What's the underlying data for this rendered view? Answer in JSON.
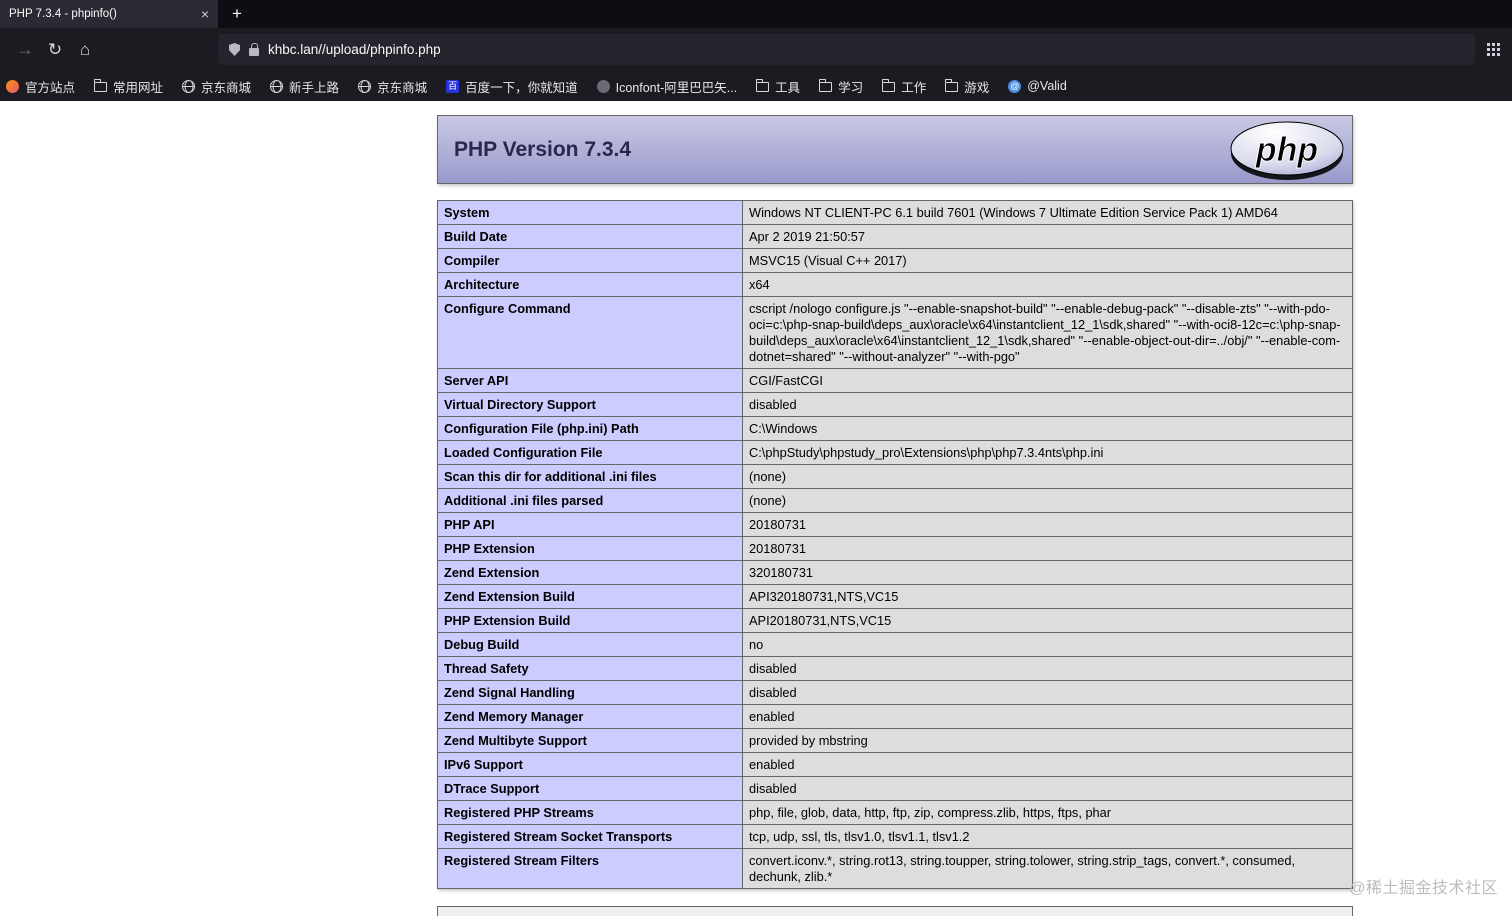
{
  "browser": {
    "tab": {
      "title": "PHP 7.3.4 - phpinfo()"
    },
    "glyphs": {
      "close": "×",
      "new_tab": "+",
      "forward": "→",
      "reload": "↻",
      "home": "⌂"
    },
    "url": "khbc.lan//upload/phpinfo.php",
    "bookmarks": [
      {
        "label": "官方站点",
        "icon": "site",
        "icon_text": ""
      },
      {
        "label": "常用网址",
        "icon": "folder",
        "icon_text": ""
      },
      {
        "label": "京东商城",
        "icon": "globe",
        "icon_text": ""
      },
      {
        "label": "新手上路",
        "icon": "globe",
        "icon_text": ""
      },
      {
        "label": "京东商城",
        "icon": "globe",
        "icon_text": ""
      },
      {
        "label": "百度一下，你就知道",
        "icon": "baidu",
        "icon_text": "百"
      },
      {
        "label": "Iconfont-阿里巴巴矢...",
        "icon": "iconfont",
        "icon_text": ""
      },
      {
        "label": "工具",
        "icon": "folder",
        "icon_text": ""
      },
      {
        "label": "学习",
        "icon": "folder",
        "icon_text": ""
      },
      {
        "label": "工作",
        "icon": "folder",
        "icon_text": ""
      },
      {
        "label": "游戏",
        "icon": "folder",
        "icon_text": ""
      },
      {
        "label": "@Valid",
        "icon": "at",
        "icon_text": "@"
      }
    ]
  },
  "page": {
    "title": "PHP Version 7.3.4",
    "logo_text": "php",
    "watermark": "@稀土掘金技术社区",
    "colors": {
      "header_bg": "#9999cc",
      "label_cell_bg": "#ccccff",
      "value_cell_bg": "#dddddd"
    },
    "info_rows": [
      {
        "label": "System",
        "value": "Windows NT CLIENT-PC 6.1 build 7601 (Windows 7 Ultimate Edition Service Pack 1) AMD64"
      },
      {
        "label": "Build Date",
        "value": "Apr 2 2019 21:50:57"
      },
      {
        "label": "Compiler",
        "value": "MSVC15 (Visual C++ 2017)"
      },
      {
        "label": "Architecture",
        "value": "x64"
      },
      {
        "label": "Configure Command",
        "value": "cscript /nologo configure.js \"--enable-snapshot-build\" \"--enable-debug-pack\" \"--disable-zts\" \"--with-pdo-oci=c:\\php-snap-build\\deps_aux\\oracle\\x64\\instantclient_12_1\\sdk,shared\" \"--with-oci8-12c=c:\\php-snap-build\\deps_aux\\oracle\\x64\\instantclient_12_1\\sdk,shared\" \"--enable-object-out-dir=../obj/\" \"--enable-com-dotnet=shared\" \"--without-analyzer\" \"--with-pgo\""
      },
      {
        "label": "Server API",
        "value": "CGI/FastCGI"
      },
      {
        "label": "Virtual Directory Support",
        "value": "disabled"
      },
      {
        "label": "Configuration File (php.ini) Path",
        "value": "C:\\Windows"
      },
      {
        "label": "Loaded Configuration File",
        "value": "C:\\phpStudy\\phpstudy_pro\\Extensions\\php\\php7.3.4nts\\php.ini"
      },
      {
        "label": "Scan this dir for additional .ini files",
        "value": "(none)"
      },
      {
        "label": "Additional .ini files parsed",
        "value": "(none)"
      },
      {
        "label": "PHP API",
        "value": "20180731"
      },
      {
        "label": "PHP Extension",
        "value": "20180731"
      },
      {
        "label": "Zend Extension",
        "value": "320180731"
      },
      {
        "label": "Zend Extension Build",
        "value": "API320180731,NTS,VC15"
      },
      {
        "label": "PHP Extension Build",
        "value": "API20180731,NTS,VC15"
      },
      {
        "label": "Debug Build",
        "value": "no"
      },
      {
        "label": "Thread Safety",
        "value": "disabled"
      },
      {
        "label": "Zend Signal Handling",
        "value": "disabled"
      },
      {
        "label": "Zend Memory Manager",
        "value": "enabled"
      },
      {
        "label": "Zend Multibyte Support",
        "value": "provided by mbstring"
      },
      {
        "label": "IPv6 Support",
        "value": "enabled"
      },
      {
        "label": "DTrace Support",
        "value": "disabled"
      },
      {
        "label": "Registered PHP Streams",
        "value": "php, file, glob, data, http, ftp, zip, compress.zlib, https, ftps, phar"
      },
      {
        "label": "Registered Stream Socket Transports",
        "value": "tcp, udp, ssl, tls, tlsv1.0, tlsv1.1, tlsv1.2"
      },
      {
        "label": "Registered Stream Filters",
        "value": "convert.iconv.*, string.rot13, string.toupper, string.tolower, string.strip_tags, convert.*, consumed, dechunk, zlib.*"
      }
    ]
  }
}
